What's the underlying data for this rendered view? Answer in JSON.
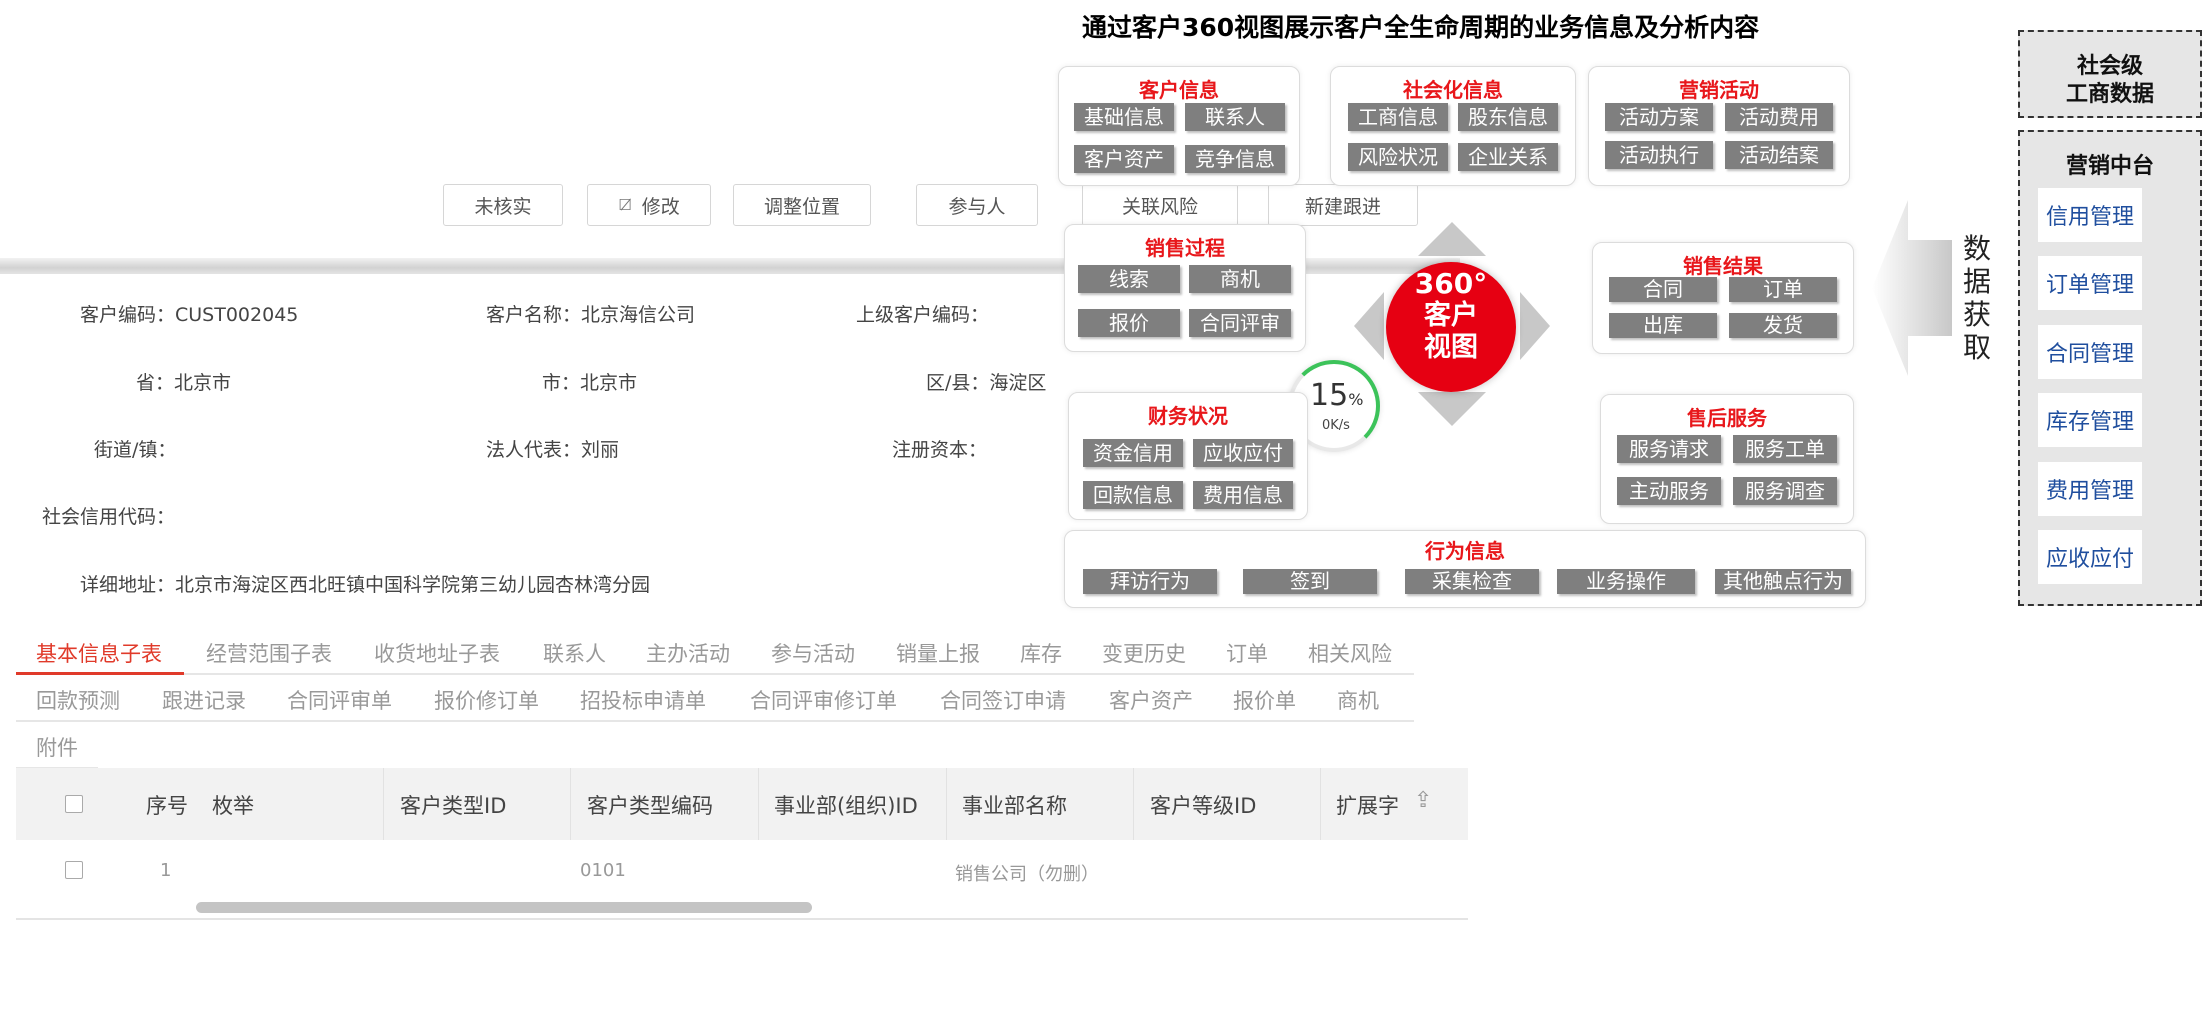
{
  "toolbar": {
    "buttons": [
      "未核实",
      "修改",
      "调整位置",
      "参与人",
      "关联风险",
      "新建跟进"
    ]
  },
  "form": {
    "customer_code": "客户编码：CUST002045",
    "customer_name": "客户名称：北京海信公司",
    "parent_code": "上级客户编码：",
    "province": "省：北京市",
    "city": "市：北京市",
    "district": "区/县：海淀区",
    "street": "街道/镇：",
    "legal_rep": "法人代表：刘丽",
    "reg_capital": "注册资本：",
    "credit_code": "社会信用代码：",
    "address": "详细地址：北京市海淀区西北旺镇中国科学院第三幼儿园杏林湾分园"
  },
  "tabs": {
    "row1": [
      "基本信息子表",
      "经营范围子表",
      "收货地址子表",
      "联系人",
      "主办活动",
      "参与活动",
      "销量上报",
      "库存",
      "变更历史",
      "订单",
      "相关风险"
    ],
    "row2": [
      "回款预测",
      "跟进记录",
      "合同评审单",
      "报价修订单",
      "招投标申请单",
      "合同评审修订单",
      "合同签订申请",
      "客户资产",
      "报价单",
      "商机"
    ],
    "row3": [
      "附件"
    ],
    "active": "基本信息子表"
  },
  "table": {
    "headers": [
      "序号",
      "枚举",
      "客户类型ID",
      "客户类型编码",
      "事业部(组织)ID",
      "事业部名称",
      "客户等级ID",
      "扩展字"
    ],
    "rows": [
      {
        "index": "1",
        "enum": "",
        "type_id": "",
        "type_code": "0101",
        "org_id": "",
        "org_name": "销售公司（勿删）",
        "level_id": "",
        "ext": ""
      }
    ]
  },
  "speed_widget": {
    "percent": "15",
    "unit": "%",
    "rate": "0K/s"
  },
  "diagram": {
    "title": "通过客户360视图展示客户全生命周期的业务信息及分析内容",
    "center": {
      "line1": "360°",
      "line2": "客户",
      "line3": "视图"
    },
    "cards": {
      "customer_info": {
        "title": "客户信息",
        "items": [
          "基础信息",
          "联系人",
          "客户资产",
          "竞争信息"
        ]
      },
      "social_info": {
        "title": "社会化信息",
        "items": [
          "工商信息",
          "股东信息",
          "风险状况",
          "企业关系"
        ]
      },
      "marketing": {
        "title": "营销活动",
        "items": [
          "活动方案",
          "活动费用",
          "活动执行",
          "活动结案"
        ]
      },
      "sales_process": {
        "title": "销售过程",
        "items": [
          "线索",
          "商机",
          "报价",
          "合同评审"
        ]
      },
      "sales_result": {
        "title": "销售结果",
        "items": [
          "合同",
          "订单",
          "出库",
          "发货"
        ]
      },
      "finance": {
        "title": "财务状况",
        "items": [
          "资金信用",
          "应收应付",
          "回款信息",
          "费用信息"
        ]
      },
      "after_sales": {
        "title": "售后服务",
        "items": [
          "服务请求",
          "服务工单",
          "主动服务",
          "服务调查"
        ]
      },
      "behavior": {
        "title": "行为信息",
        "items": [
          "拜访行为",
          "签到",
          "采集检查",
          "业务操作",
          "其他触点行为"
        ]
      }
    },
    "colors": {
      "accent_red": "#e8171b",
      "chip_gray": "#7f7f7f",
      "center_red": "#e60012"
    }
  },
  "right_panel": {
    "data_fetch": "数据获取",
    "social_box": {
      "line1": "社会级",
      "line2": "工商数据"
    },
    "platform": {
      "title": "营销中台",
      "items": [
        "信用管理",
        "订单管理",
        "合同管理",
        "库存管理",
        "费用管理",
        "应收应付"
      ]
    }
  }
}
